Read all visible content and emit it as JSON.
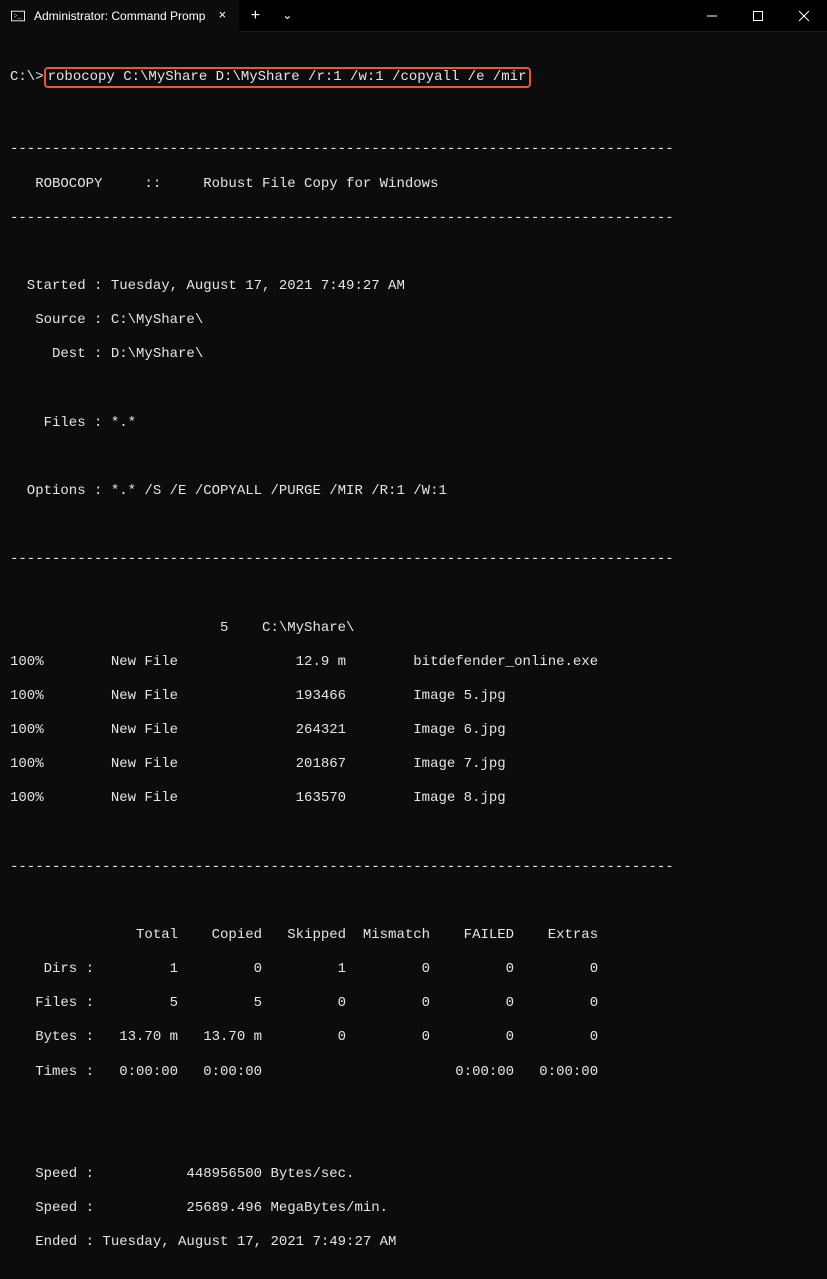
{
  "titlebar": {
    "tab_title": "Administrator: Command Promp",
    "tab_close": "×",
    "new_tab": "+",
    "dropdown": "⌄"
  },
  "terminal": {
    "prompt": "C:\\>",
    "command": "robocopy C:\\MyShare D:\\MyShare /r:1 /w:1 /copyall /e /mir",
    "dash_line": "-------------------------------------------------------------------------------",
    "header": "   ROBOCOPY     ::     Robust File Copy for Windows",
    "started_line": "  Started : Tuesday, August 17, 2021 7:49:27 AM",
    "source_line": "   Source : C:\\MyShare\\",
    "dest_line": "     Dest : D:\\MyShare\\",
    "files_line": "    Files : *.*",
    "options_line": "  Options : *.* /S /E /COPYALL /PURGE /MIR /R:1 /W:1",
    "dir_header": "                         5    C:\\MyShare\\",
    "file1": "100%        New File              12.9 m        bitdefender_online.exe",
    "file2": "100%        New File              193466        Image 5.jpg",
    "file3": "100%        New File              264321        Image 6.jpg",
    "file4": "100%        New File              201867        Image 7.jpg",
    "file5": "100%        New File              163570        Image 8.jpg",
    "summary_header": "               Total    Copied   Skipped  Mismatch    FAILED    Extras",
    "dirs_row": "    Dirs :         1         0         1         0         0         0",
    "files_row": "   Files :         5         5         0         0         0         0",
    "bytes_row": "   Bytes :   13.70 m   13.70 m         0         0         0         0",
    "times_row": "   Times :   0:00:00   0:00:00                       0:00:00   0:00:00",
    "speed1": "   Speed :           448956500 Bytes/sec.",
    "speed2": "   Speed :           25689.496 MegaBytes/min.",
    "ended": "   Ended : Tuesday, August 17, 2021 7:49:27 AM"
  }
}
